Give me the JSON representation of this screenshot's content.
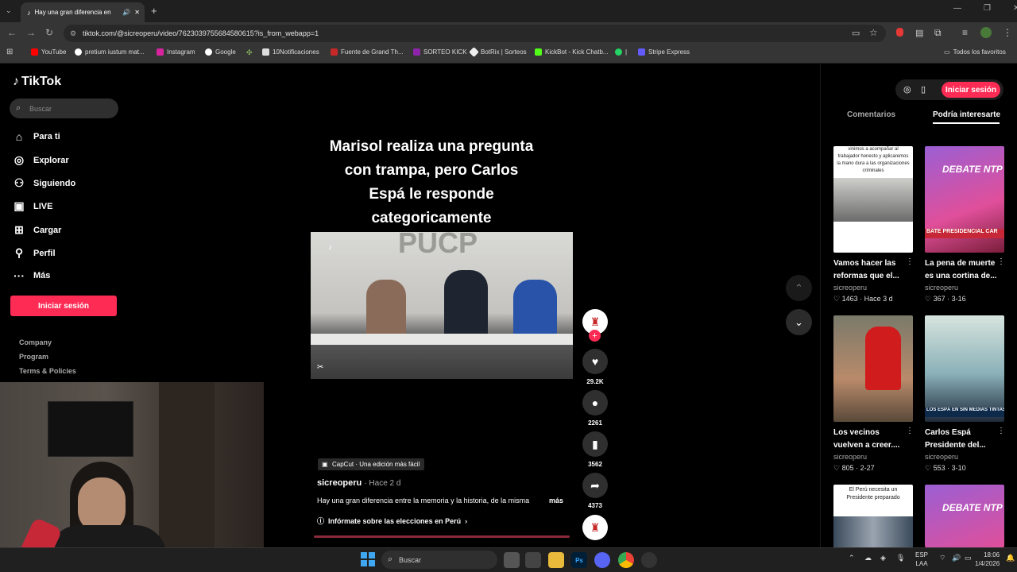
{
  "browser": {
    "tab_title": "Hay una gran diferencia en",
    "url": "tiktok.com/@sicreoperu/video/7623039755684580615?is_from_webapp=1",
    "bookmarks": [
      "YouTube",
      "pretium iustum mat...",
      "Instagram",
      "Google",
      "10Notificaciones",
      "Fuente de Grand Th...",
      "SORTEO KICK",
      "BotRix | Sorteos",
      "KickBot - Kick Chatb...",
      "|",
      "Stripe Express"
    ],
    "bookmarks_all": "Todos los favoritos"
  },
  "sidebar": {
    "logo": "TikTok",
    "search_placeholder": "Buscar",
    "items": [
      {
        "label": "Para ti",
        "icon": "home-icon"
      },
      {
        "label": "Explorar",
        "icon": "compass-icon"
      },
      {
        "label": "Siguiendo",
        "icon": "user-follow-icon"
      },
      {
        "label": "LIVE",
        "icon": "live-icon"
      },
      {
        "label": "Cargar",
        "icon": "upload-icon"
      },
      {
        "label": "Perfil",
        "icon": "profile-icon"
      },
      {
        "label": "Más",
        "icon": "more-icon"
      }
    ],
    "login": "Iniciar sesión",
    "footer": [
      "Company",
      "Program",
      "Terms & Policies"
    ]
  },
  "video": {
    "caption_lines": [
      "Marisol realiza una pregunta",
      "con trampa, pero Carlos",
      "Espá le responde",
      "categoricamente"
    ],
    "capcut": "CapCut · Una edición más fácil",
    "author": "sicreoperu",
    "time": "· Hace 2 d",
    "description": "Hay una gran diferencia entre la memoria y la historia, de la misma",
    "more": "más",
    "elections": "Infórmate sobre las elecciones en Perú",
    "likes": "29.2K",
    "comments": "2261",
    "saves": "3562",
    "shares": "4373"
  },
  "right": {
    "login": "Iniciar sesión",
    "tab_comments": "Comentarios",
    "tab_interest": "Podría interesarte",
    "cards": [
      {
        "title": "Vamos hacer las reformas que el...",
        "author": "sicreoperu",
        "stats": "♡ 1463 · Hace 3 d",
        "overlay": "vinimos a acompañar al trabajador honesto y aplicaremos la mano dura a las organizaciones criminales"
      },
      {
        "title": "La pena de muerte es una cortina de...",
        "author": "sicreoperu",
        "stats": "♡ 367 · 3-16",
        "overlay": "BATE PRESIDENCIAL CAR"
      },
      {
        "title": "Los vecinos vuelven a creer....",
        "author": "sicreoperu",
        "stats": "♡ 805 · 2-27",
        "overlay": ""
      },
      {
        "title": "Carlos Espá Presidente del...",
        "author": "sicreoperu",
        "stats": "♡ 553 · 3-10",
        "overlay": "LOS ESPÁ EN SIN MEDIAS TINTAS"
      }
    ],
    "bottom_overlay": "El Perú necesita un Presidente preparado",
    "debate": "DEBATE NTP"
  },
  "taskbar": {
    "search": "Buscar",
    "lang1": "ESP",
    "lang2": "LAA",
    "time": "18:06",
    "date": "1/4/2026"
  }
}
